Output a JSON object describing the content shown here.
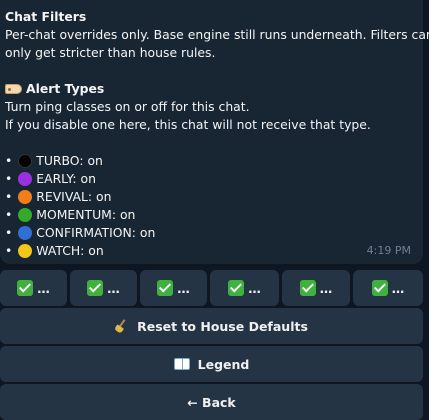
{
  "message": {
    "title": "Chat Filters",
    "intro_line1": "Per-chat overrides only. Base engine still runs underneath. Filters can",
    "intro_line2": "only get stricter than house rules.",
    "alert_heading": "Alert Types",
    "desc_line1": "Turn ping classes on or off for this chat.",
    "desc_line2": "If you disable one here, this chat will not receive that type.",
    "alerts": [
      {
        "name": "TURBO",
        "state": "on",
        "color": "#000000"
      },
      {
        "name": "EARLY",
        "state": "on",
        "color": "#9b30e0"
      },
      {
        "name": "REVIVAL",
        "state": "on",
        "color": "#f07f1a"
      },
      {
        "name": "MOMENTUM",
        "state": "on",
        "color": "#35a92c"
      },
      {
        "name": "CONFIRMATION",
        "state": "on",
        "color": "#2f6fd8"
      },
      {
        "name": "WATCH",
        "state": "on",
        "color": "#f5c518"
      }
    ],
    "bullet": "•",
    "time": "4:19 PM"
  },
  "keyboard": {
    "toggle_buttons": [
      "…",
      "…",
      "…",
      "…",
      "…",
      "…"
    ],
    "reset_label": "Reset to House Defaults",
    "legend_label": "Legend",
    "back_label": "← Back"
  }
}
